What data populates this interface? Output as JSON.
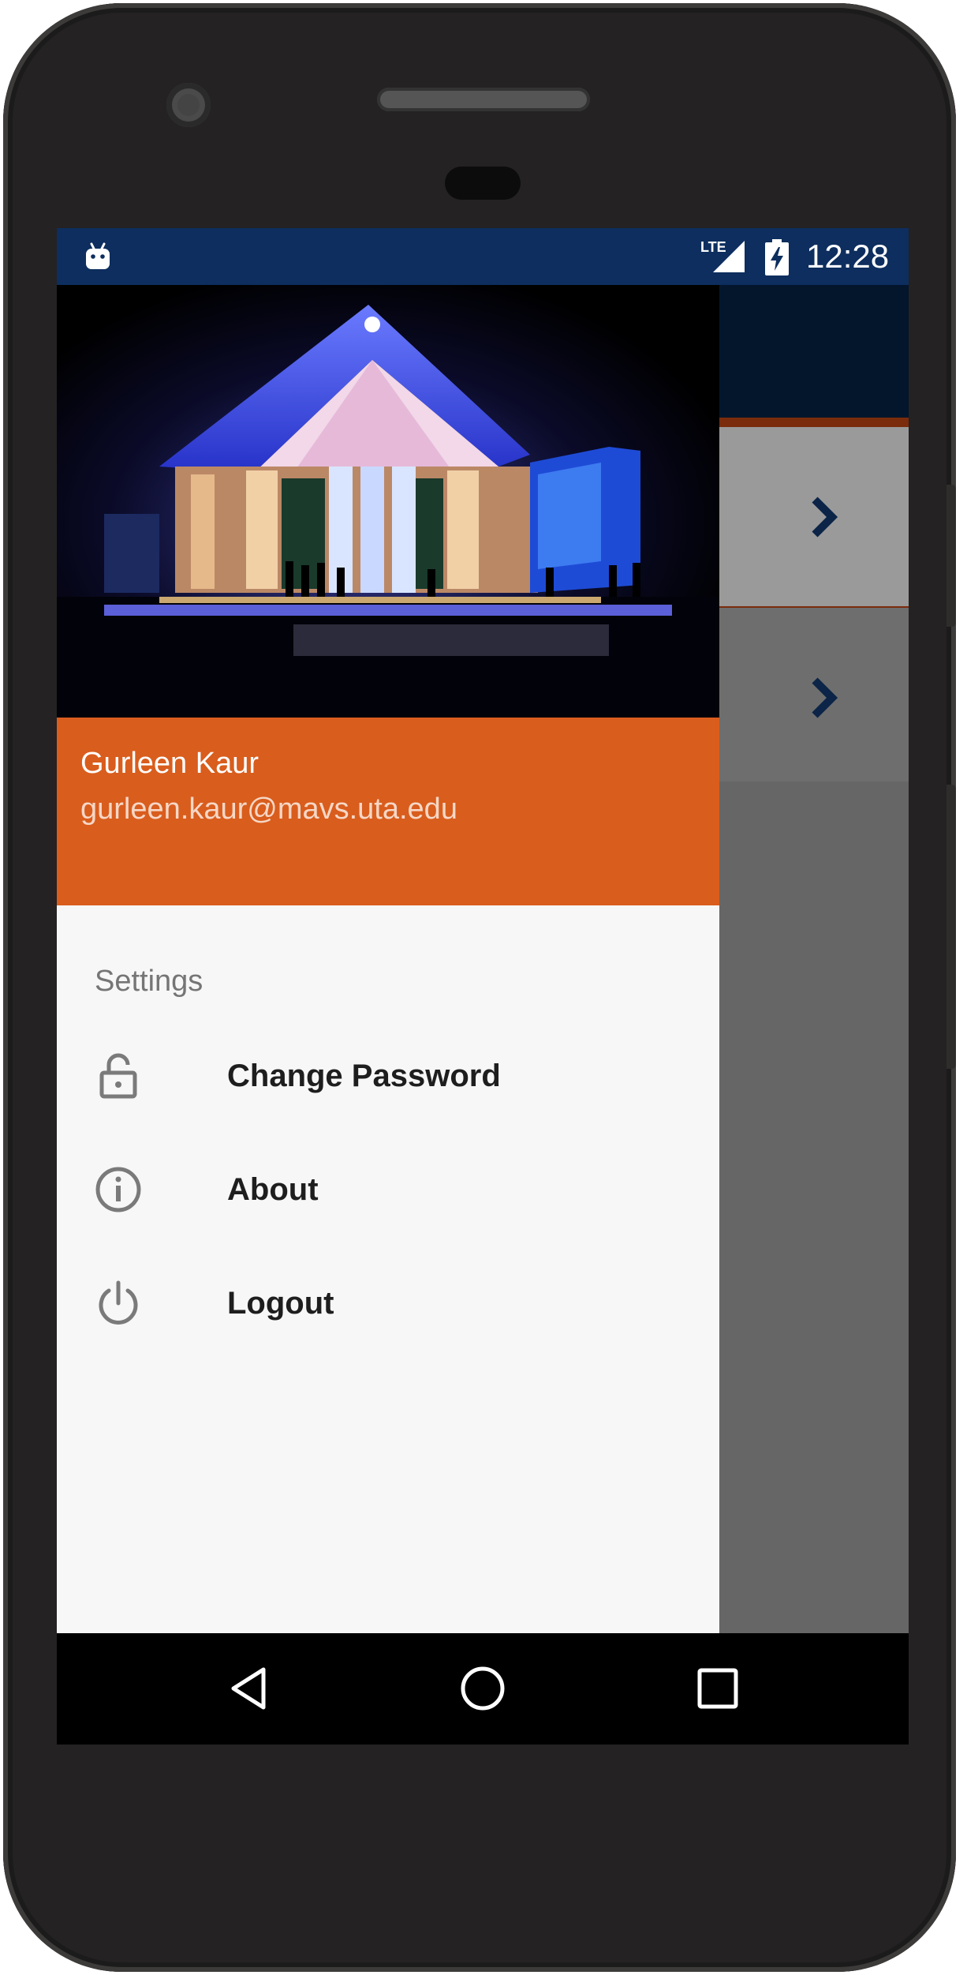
{
  "status_bar": {
    "time": "12:28",
    "network": "LTE",
    "notification_icon": "android-debug-icon",
    "signal_icon": "signal-icon",
    "battery_icon": "battery-charging-icon"
  },
  "drawer": {
    "header": {
      "image_icon": "campus-building-photo",
      "name": "Gurleen Kaur",
      "email": "gurleen.kaur@mavs.uta.edu"
    },
    "section_title": "Settings",
    "items": [
      {
        "label": "Change Password",
        "icon": "lock-icon"
      },
      {
        "label": "About",
        "icon": "info-icon"
      },
      {
        "label": "Logout",
        "icon": "power-icon"
      }
    ]
  },
  "background_app": {
    "row_icons": [
      "chevron-right-icon",
      "chevron-right-icon"
    ]
  },
  "nav_bar": {
    "back_icon": "back-icon",
    "home_icon": "home-icon",
    "recents_icon": "recents-icon"
  },
  "colors": {
    "status_bar": "#0d2e5e",
    "header_accent": "#d95d1d",
    "drawer_bg": "#f7f7f7",
    "scrim": "#666666"
  }
}
